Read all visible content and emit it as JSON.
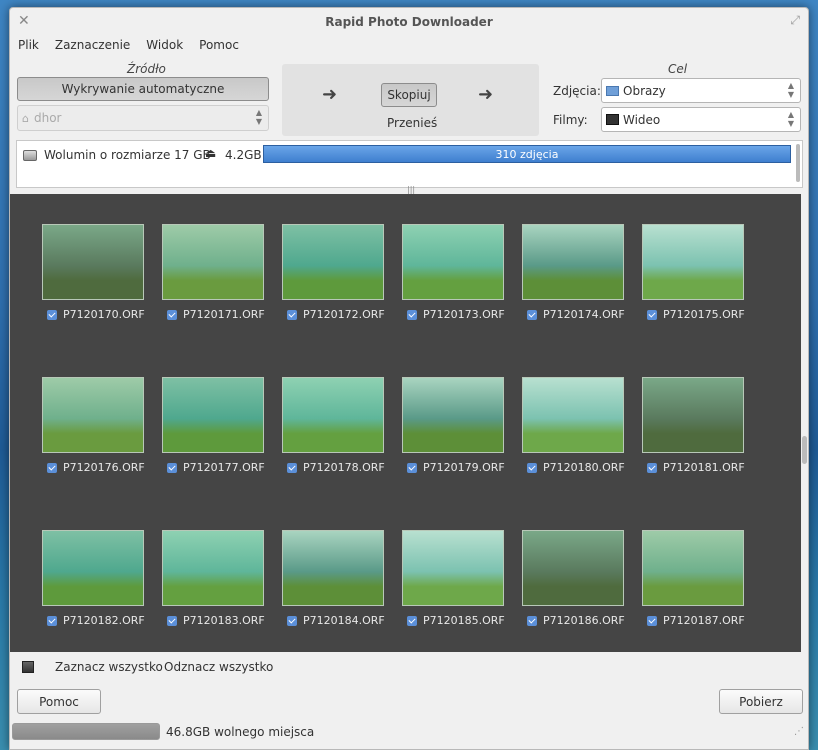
{
  "window": {
    "title": "Rapid Photo Downloader"
  },
  "menu": [
    "Plik",
    "Zaznaczenie",
    "Widok",
    "Pomoc"
  ],
  "source": {
    "label": "Źródło",
    "auto_detect_label": "Wykrywanie automatyczne",
    "location_value": "dhor"
  },
  "actions": {
    "copy_label": "Skopiuj",
    "move_label": "Przenieś"
  },
  "destination": {
    "label": "Cel",
    "photos_label": "Zdjęcia:",
    "photos_value": "Obrazy",
    "videos_label": "Filmy:",
    "videos_value": "Wideo"
  },
  "device": {
    "name": "Wolumin o rozmiarze 17 GB",
    "size": "4.2GB",
    "progress_text": "310 zdjęcia",
    "progress": 1.0
  },
  "thumbnails": [
    {
      "name": "P7120170.ORF",
      "checked": true
    },
    {
      "name": "P7120171.ORF",
      "checked": true
    },
    {
      "name": "P7120172.ORF",
      "checked": true
    },
    {
      "name": "P7120173.ORF",
      "checked": true
    },
    {
      "name": "P7120174.ORF",
      "checked": true
    },
    {
      "name": "P7120175.ORF",
      "checked": true
    },
    {
      "name": "P7120176.ORF",
      "checked": true
    },
    {
      "name": "P7120177.ORF",
      "checked": true
    },
    {
      "name": "P7120178.ORF",
      "checked": true
    },
    {
      "name": "P7120179.ORF",
      "checked": true
    },
    {
      "name": "P7120180.ORF",
      "checked": true
    },
    {
      "name": "P7120181.ORF",
      "checked": true
    },
    {
      "name": "P7120182.ORF",
      "checked": true
    },
    {
      "name": "P7120183.ORF",
      "checked": true
    },
    {
      "name": "P7120184.ORF",
      "checked": true
    },
    {
      "name": "P7120185.ORF",
      "checked": true
    },
    {
      "name": "P7120186.ORF",
      "checked": true
    },
    {
      "name": "P7120187.ORF",
      "checked": true
    }
  ],
  "selection": {
    "select_all_label": "Zaznacz wszystko",
    "deselect_all_label": "Odznacz wszystko"
  },
  "buttons": {
    "help_label": "Pomoc",
    "download_label": "Pobierz"
  },
  "status": {
    "free_space_text": "46.8GB wolnego miejsca"
  },
  "colors": {
    "accent": "#4a8be0",
    "gallery_bg": "#454545"
  }
}
